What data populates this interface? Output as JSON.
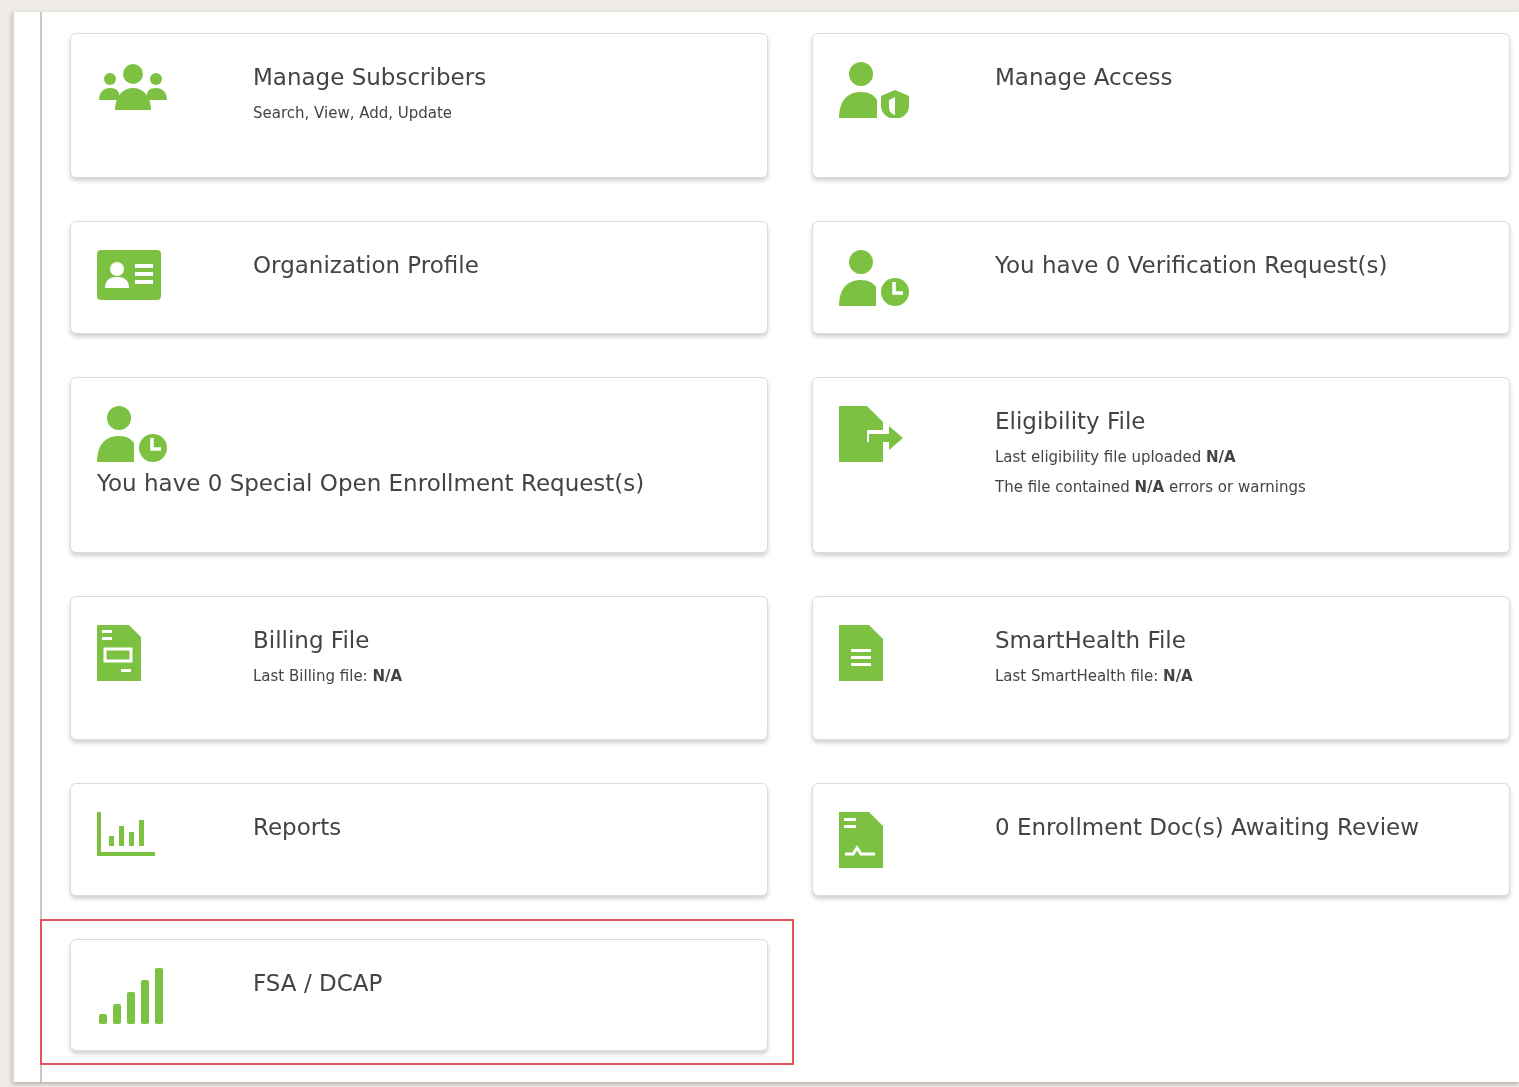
{
  "cards": [
    {
      "kind": "side",
      "title": "Manage Subscribers",
      "lines": [
        "Search, View, Add, Update"
      ],
      "highlighted": false
    },
    {
      "kind": "side",
      "title": "Manage Access",
      "highlighted": false
    },
    {
      "kind": "side",
      "title": "Organization Profile",
      "highlighted": false
    },
    {
      "kind": "side",
      "title": "You have 0 Verification Request(s)",
      "highlighted": false
    },
    {
      "kind": "stacked",
      "title": "You have 0 Special Open Enrollment Request(s)",
      "highlighted": false
    },
    {
      "kind": "side",
      "title": "Eligibility File",
      "lines": [
        "Last eligibility file uploaded **N/A**",
        "The file contained **N/A** errors or warnings"
      ],
      "highlighted": false
    },
    {
      "kind": "side",
      "title": "Billing File",
      "lines": [
        "Last Billing file: **N/A**"
      ],
      "highlighted": false
    },
    {
      "kind": "side",
      "title": "SmartHealth File",
      "lines": [
        "Last SmartHealth file: **N/A**"
      ],
      "highlighted": false
    },
    {
      "kind": "side",
      "title": "Reports",
      "highlighted": false
    },
    {
      "kind": "side",
      "title": "0 Enrollment Doc(s) Awaiting Review",
      "highlighted": false
    },
    {
      "kind": "side",
      "title": "FSA / DCAP",
      "highlighted": true
    }
  ]
}
